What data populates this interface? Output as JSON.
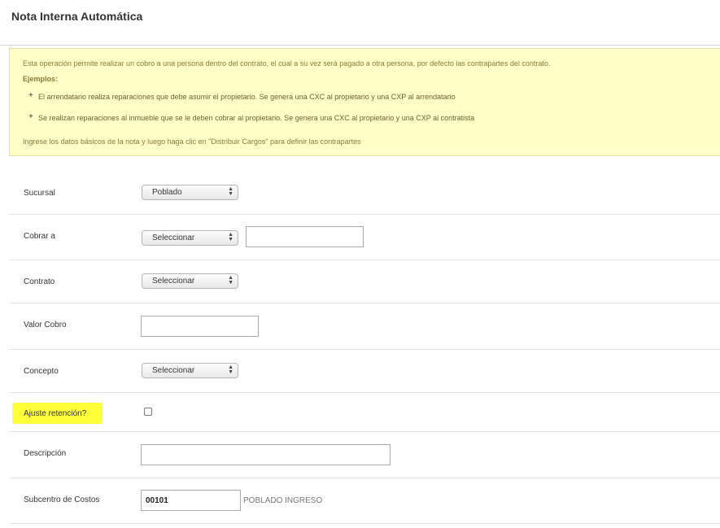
{
  "header": {
    "title": "Nota Interna Automática"
  },
  "info": {
    "intro": "Esta operación permite realizar un cobro a una persona dentro del contrato, el cual a su vez será pagado a otra persona, por defecto las contrapartes del contrato.",
    "examples_label": "Ejemplos:",
    "examples": [
      "El arrendatario realiza reparaciones que debe asumir el propietario. Se genera una CXC al propietario y una CXP al arrendatario",
      "Se realizan reparaciones al inmueble que se le deben cobrar al propietario. Se genera una CXC al propietario y una CXP al contratista"
    ],
    "bullet_glyph": "+",
    "footer": "Ingrese los datos básicos de la nota y luego haga clic en \"Distribuir Cargos\" para definir las contrapartes"
  },
  "form": {
    "sucursal": {
      "label": "Sucursal",
      "value": "Poblado"
    },
    "cobrar_a": {
      "label": "Cobrar a",
      "value": "Seleccionar",
      "text_value": ""
    },
    "contrato": {
      "label": "Contrato",
      "value": "Seleccionar"
    },
    "valor_cobro": {
      "label": "Valor Cobro",
      "value": ""
    },
    "concepto": {
      "label": "Concepto",
      "value": "Seleccionar"
    },
    "ajuste_retencion": {
      "label": "Ajuste retención?",
      "checked": false
    },
    "descripcion": {
      "label": "Descripción",
      "value": ""
    },
    "subcentro": {
      "label": "Subcentro de Costos",
      "value": "00101",
      "description": "POBLADO INGRESO"
    }
  },
  "colors": {
    "info_background": "#ffffc8",
    "info_text": "#8a7a35",
    "highlight": "#ffff3a"
  },
  "icons": {
    "select_arrow": "chevron-up-down-icon"
  }
}
